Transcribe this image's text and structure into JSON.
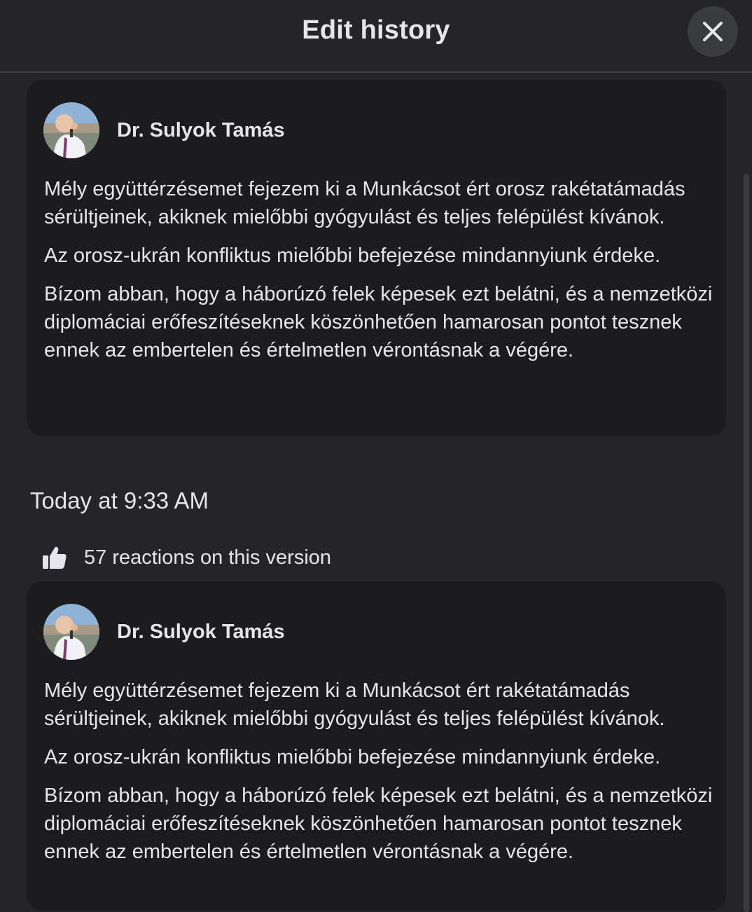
{
  "header": {
    "title": "Edit history",
    "close_icon": "close-icon"
  },
  "versions": [
    {
      "author": "Dr. Sulyok Tamás",
      "paragraphs": [
        "Mély együttérzésemet fejezem ki a Munkácsot ért orosz rakétatámadás sérültjeinek, akiknek mielőbbi gyógyulást és teljes felépülést kívánok.",
        "Az orosz-ukrán konfliktus mielőbbi befejezése mindannyiunk érdeke.",
        "Bízom abban, hogy a háborúzó felek képesek ezt belátni, és a nemzetközi diplomáciai erőfeszítéseknek köszönhetően hamarosan pontot tesznek ennek az embertelen és értelmetlen vérontásnak a végére."
      ]
    },
    {
      "timestamp": "Today at 9:33 AM",
      "reactions": "57 reactions on this version",
      "reaction_icon": "thumbs-up-icon",
      "author": "Dr. Sulyok Tamás",
      "paragraphs": [
        "Mély együttérzésemet fejezem ki a Munkácsot ért rakétatámadás sérültjeinek, akiknek mielőbbi gyógyulást és teljes felépülést kívánok.",
        "Az orosz-ukrán konfliktus mielőbbi befejezése mindannyiunk érdeke.",
        "Bízom abban, hogy a háborúzó felek képesek ezt belátni, és a nemzetközi diplomáciai erőfeszítéseknek köszönhetően hamarosan pontot tesznek ennek az embertelen és értelmetlen vérontásnak a végére."
      ]
    }
  ],
  "colors": {
    "background": "#252528",
    "card": "#1c1c1e",
    "text": "#e4e6eb",
    "divider": "#3e4042"
  }
}
